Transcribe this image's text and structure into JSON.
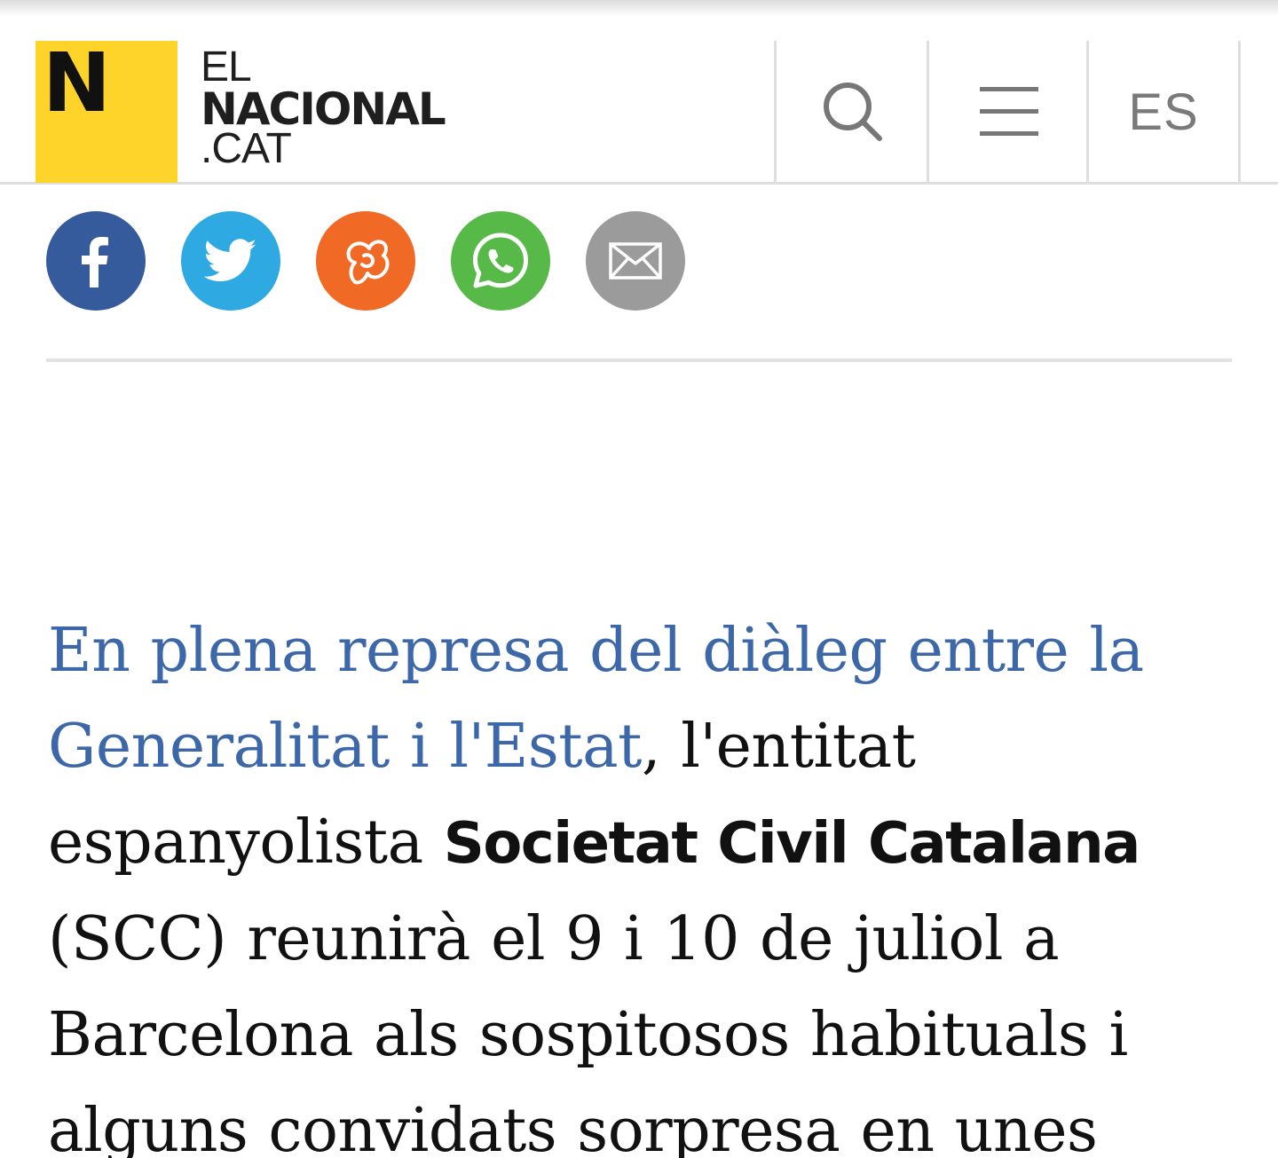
{
  "header": {
    "logo": {
      "mark": "N",
      "line1": "EL",
      "line2": "NACIONAL",
      "line3": ".CAT",
      "mark_color": "#ffd42a"
    },
    "search_icon": "search-icon",
    "menu_icon": "hamburger-menu-icon",
    "language_label": "ES"
  },
  "share": {
    "buttons": [
      {
        "name": "facebook",
        "icon": "facebook-icon",
        "color": "#365b9c"
      },
      {
        "name": "twitter",
        "icon": "twitter-icon",
        "color": "#2fa9e2"
      },
      {
        "name": "meneame",
        "icon": "meneame-icon",
        "color": "#f06a25"
      },
      {
        "name": "whatsapp",
        "icon": "whatsapp-icon",
        "color": "#57b947"
      },
      {
        "name": "email",
        "icon": "email-icon",
        "color": "#9b9b9b"
      }
    ]
  },
  "article": {
    "link_text": "En plena represa del diàleg entre la Generalitat i l'Estat",
    "text_after_link": ", l'entitat espanyolista ",
    "bold_text": "Societat Civil Catalana",
    "text_rest": " (SCC) reunirà el 9 i 10 de juliol a Barcelona als sospitosos habituals i alguns convidats sorpresa en unes",
    "link_color": "#3c67a8"
  }
}
